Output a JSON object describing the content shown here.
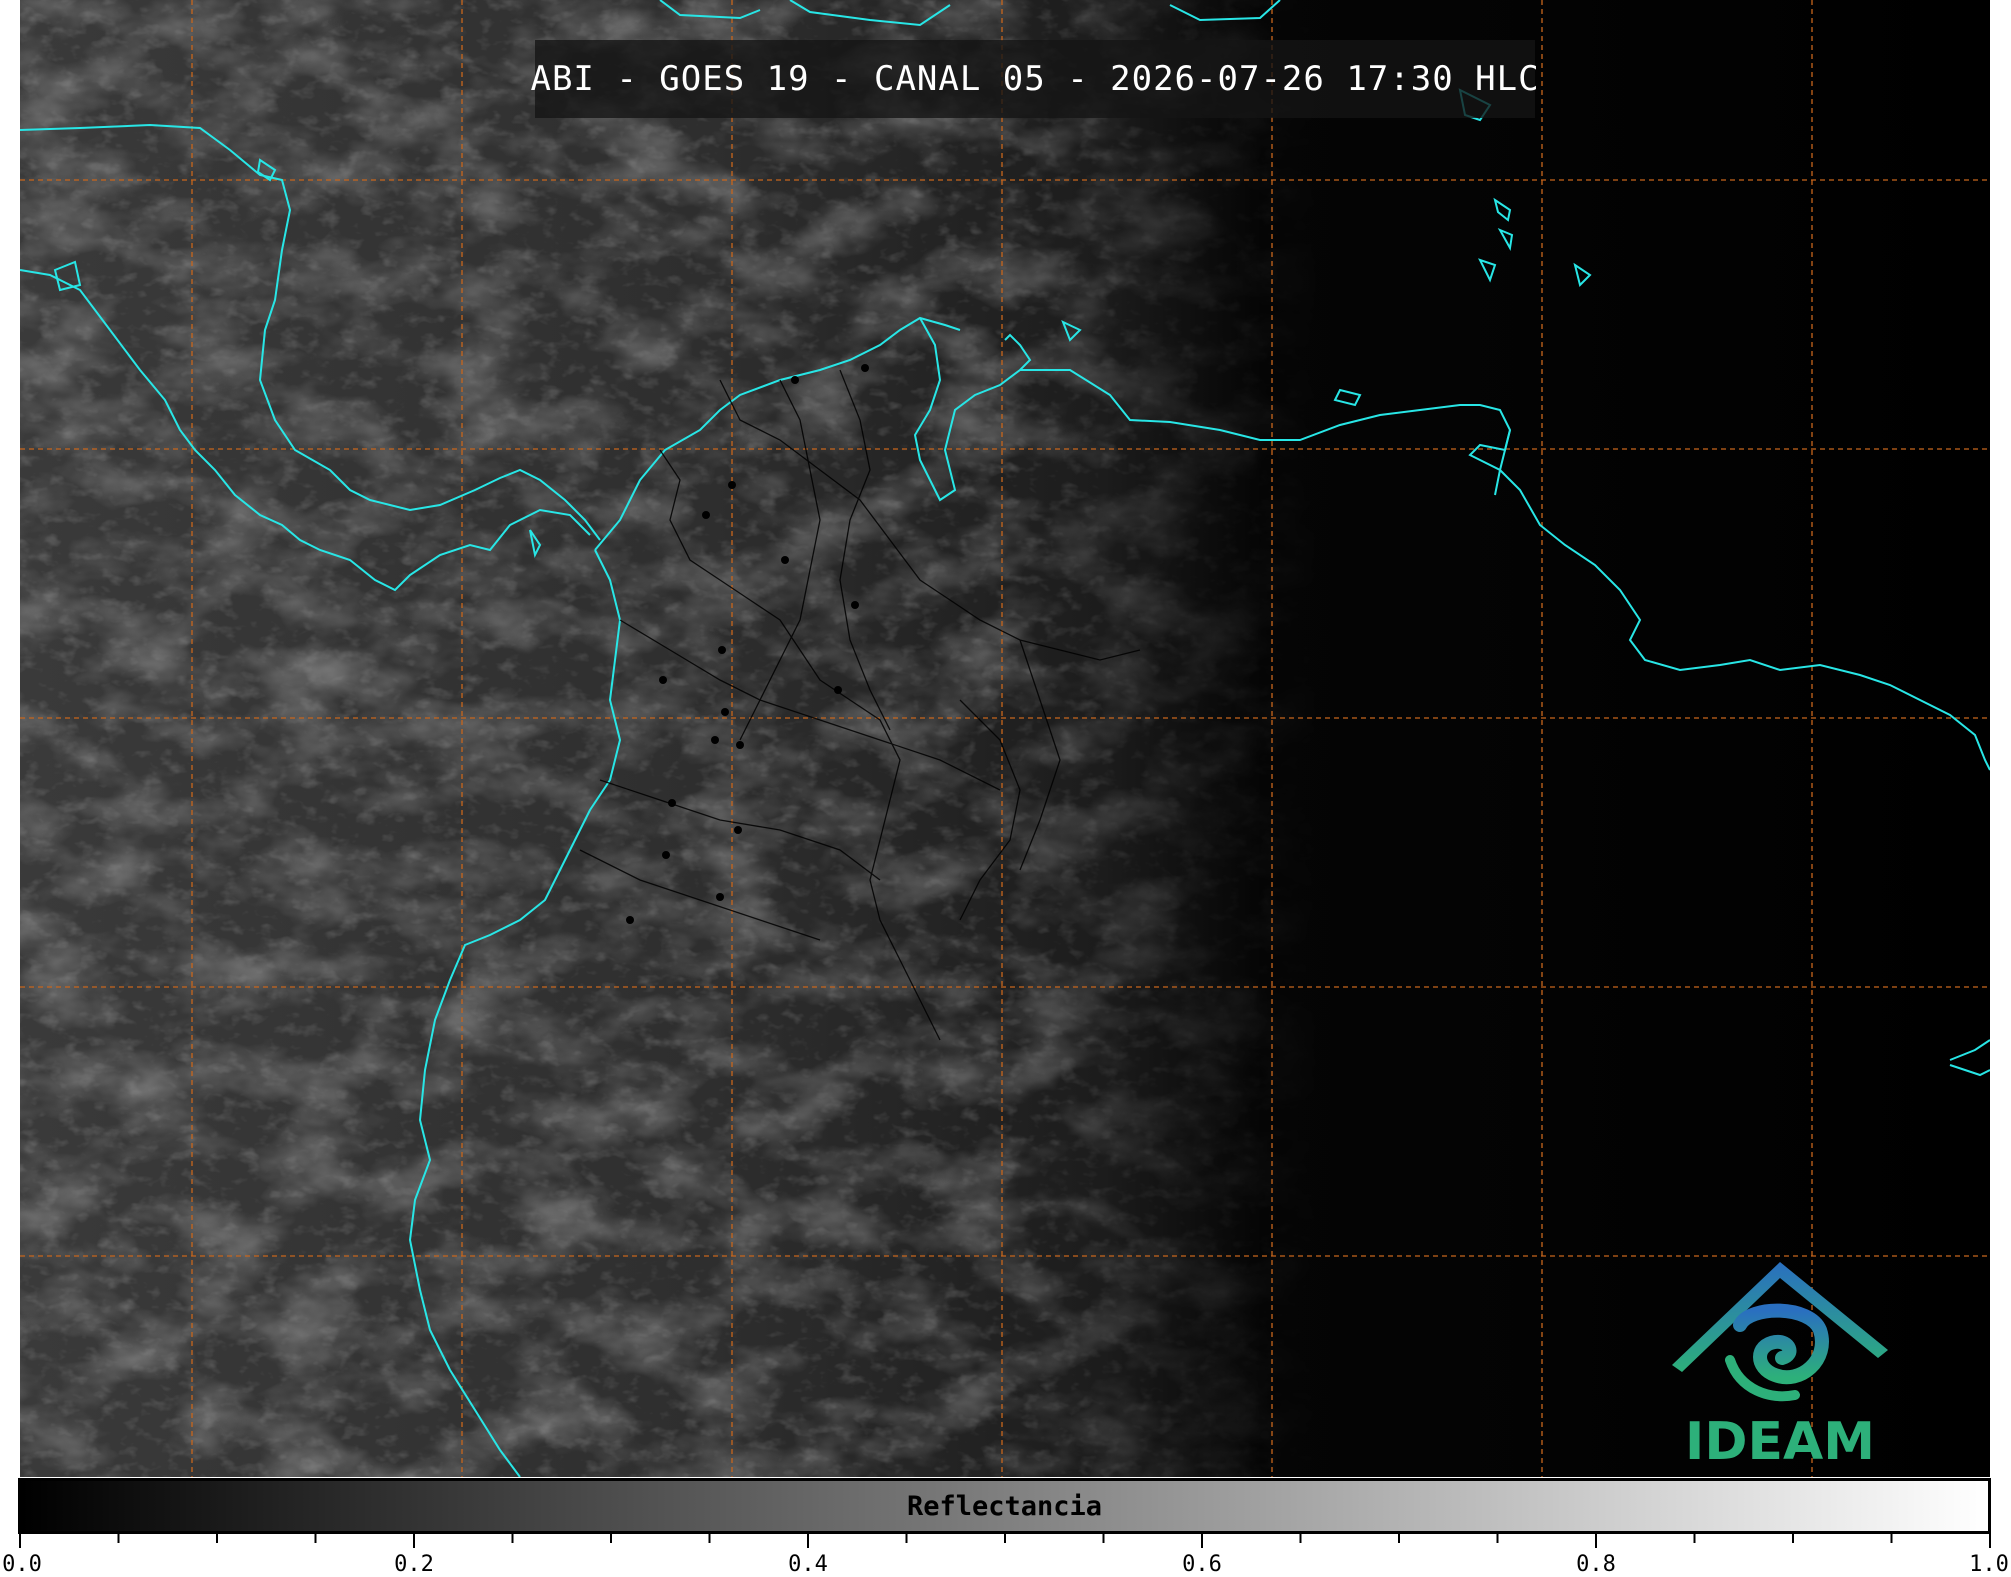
{
  "title": "ABI - GOES 19 - CANAL 05 - 2026-07-26 17:30 HLC",
  "logo": {
    "text": "IDEAM",
    "icon": "ideam-logo-icon",
    "colors": {
      "text": "#2db07a",
      "blue": "#2a7fc0",
      "green": "#2db07a"
    }
  },
  "colorbar": {
    "label": "Reflectancia",
    "range": [
      0.0,
      1.0
    ],
    "tick_labels": [
      "0.0",
      "0.2",
      "0.4",
      "0.6",
      "0.8",
      "1.0"
    ],
    "colormap": "grayscale black-to-white"
  },
  "map": {
    "grid_color": "#c8661c",
    "coastline_color": "#28e6e6",
    "border_color": "#000000",
    "background": "satellite visible reflectance imagery"
  }
}
